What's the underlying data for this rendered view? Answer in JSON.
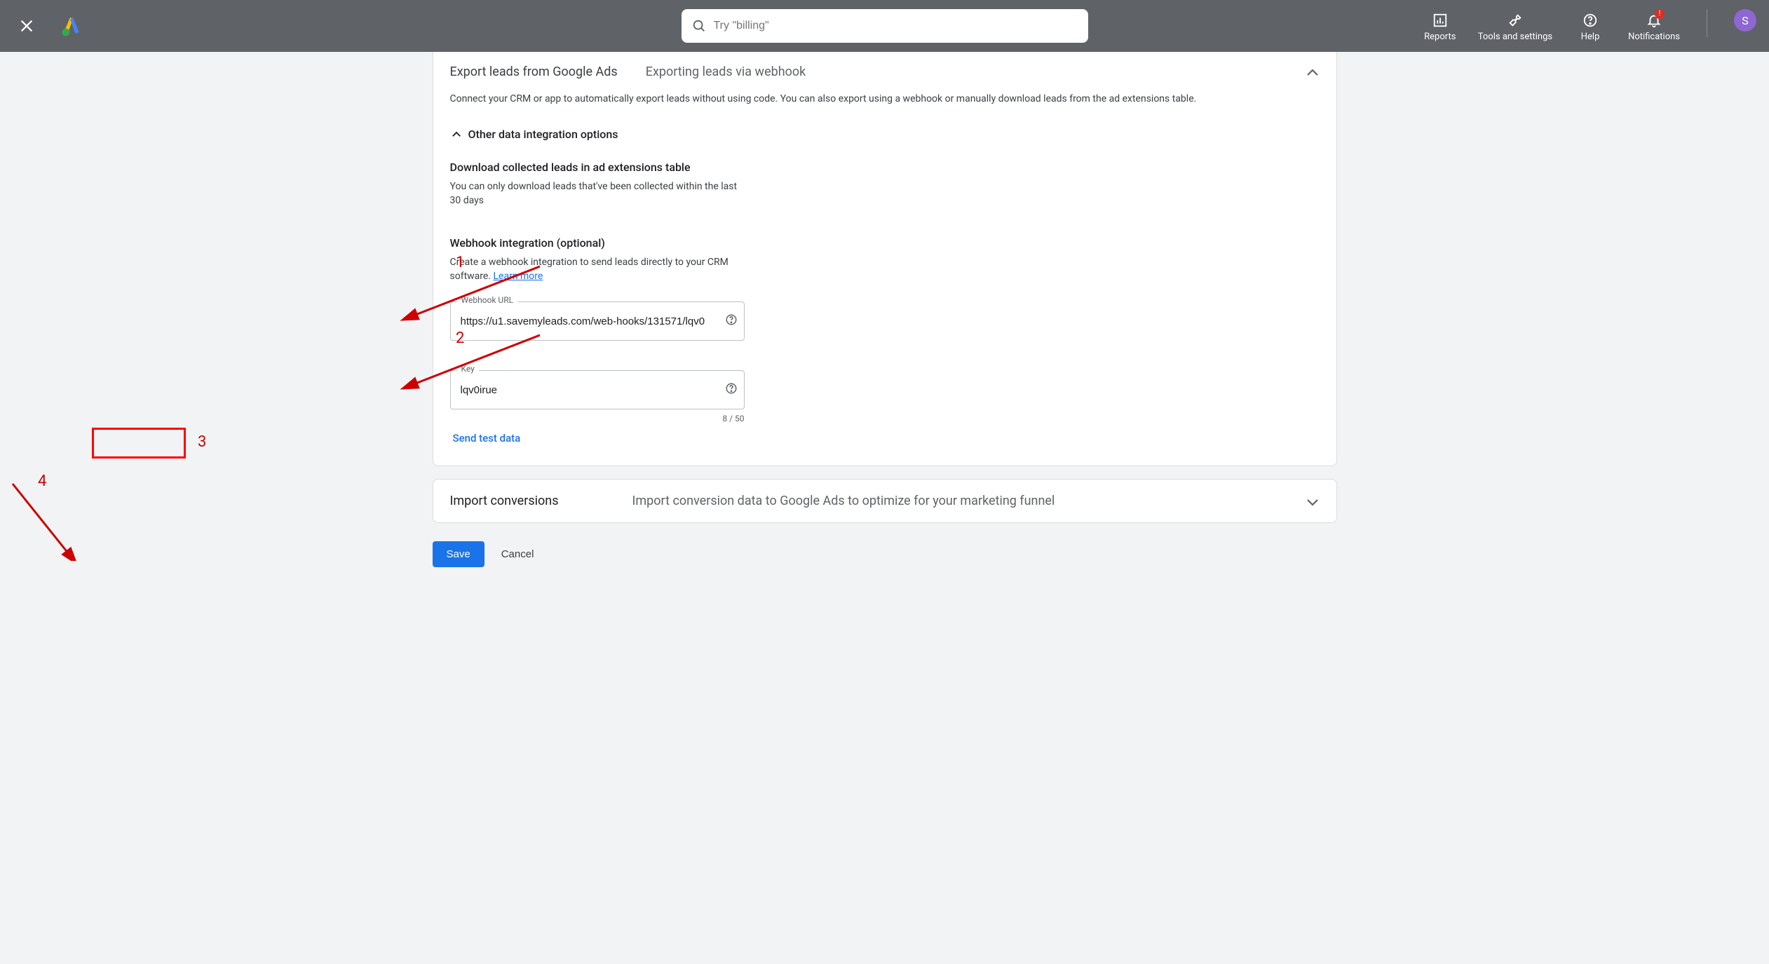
{
  "header": {
    "search_placeholder": "Try \"billing\"",
    "items": {
      "reports": "Reports",
      "tools": "Tools and settings",
      "help": "Help",
      "notifications": "Notifications"
    },
    "avatar_letter": "S"
  },
  "export_card": {
    "title": "Export leads from Google Ads",
    "subtitle": "Exporting leads via webhook",
    "desc": "Connect your CRM or app to automatically export leads without using code. You can also export using a webhook or manually download leads from the ad extensions table.",
    "other_options": "Other data integration options",
    "download_h": "Download collected leads in ad extensions table",
    "download_p": "You can only download leads that've been collected within the last 30 days",
    "webhook_h": "Webhook integration (optional)",
    "webhook_p_pre": "Create a webhook integration to send leads directly to your CRM software. ",
    "learn_more": "Learn more",
    "url_label": "Webhook URL",
    "url_value": "https://u1.savemyleads.com/web-hooks/131571/lqv0",
    "key_label": "Key",
    "key_value": "lqv0irue",
    "key_count": "8 / 50",
    "send_test": "Send test data"
  },
  "import_card": {
    "title": "Import conversions",
    "desc": "Import conversion data to Google Ads to optimize for your marketing funnel"
  },
  "footer": {
    "save": "Save",
    "cancel": "Cancel"
  },
  "annotations": {
    "n1": "1",
    "n2": "2",
    "n3": "3",
    "n4": "4"
  }
}
